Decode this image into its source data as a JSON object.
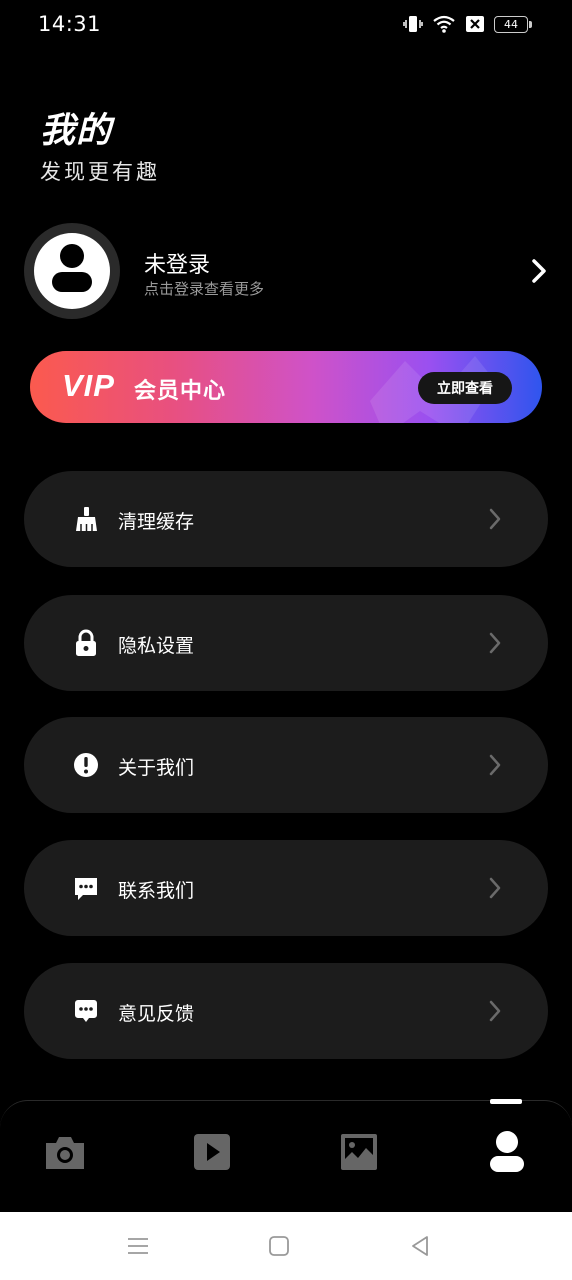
{
  "status_bar": {
    "time": "14:31",
    "battery": "44",
    "icons": [
      "vibrate-icon",
      "wifi-icon",
      "sim-off-icon",
      "battery-icon"
    ]
  },
  "header": {
    "title": "我的",
    "subtitle": "发现更有趣"
  },
  "profile": {
    "name": "未登录",
    "hint": "点击登录查看更多"
  },
  "vip": {
    "logo": "VIP",
    "title": "会员中心",
    "button": "立即查看"
  },
  "menu": [
    {
      "label": "清理缓存",
      "icon": "broom-icon"
    },
    {
      "label": "隐私设置",
      "icon": "lock-icon"
    },
    {
      "label": "关于我们",
      "icon": "info-icon"
    },
    {
      "label": "联系我们",
      "icon": "message-icon"
    },
    {
      "label": "意见反馈",
      "icon": "feedback-icon"
    }
  ],
  "tabbar": {
    "tabs": [
      "camera-icon",
      "video-icon",
      "photo-icon",
      "profile-icon"
    ],
    "active": "profile-icon"
  },
  "colors": {
    "background": "#000000",
    "card": "#1c1c1c",
    "vip_start": "#fb5a4e",
    "vip_mid": "#cf52c8",
    "vip_end": "#2f55ee",
    "inactive_tab": "#666666"
  }
}
